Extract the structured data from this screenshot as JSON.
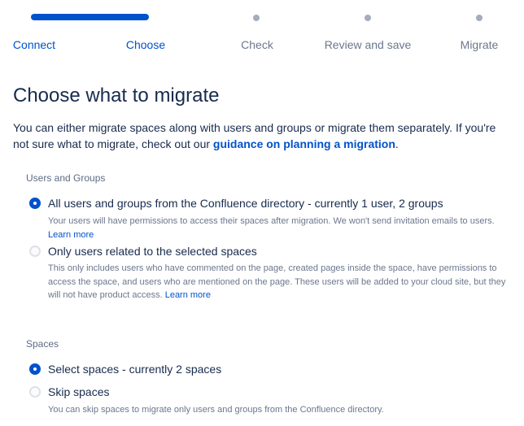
{
  "progress": {
    "steps": [
      {
        "label": "Connect",
        "state": "done"
      },
      {
        "label": "Choose",
        "state": "current"
      },
      {
        "label": "Check",
        "state": "todo"
      },
      {
        "label": "Review and save",
        "state": "todo"
      },
      {
        "label": "Migrate",
        "state": "todo"
      }
    ]
  },
  "page": {
    "title": "Choose what to migrate",
    "intro_text": "You can either migrate spaces along with users and groups or migrate them separately. If you're not sure what to migrate, check out our ",
    "intro_link": "guidance on planning a migration",
    "intro_end": "."
  },
  "users_groups": {
    "label": "Users and Groups",
    "options": [
      {
        "label": "All users and groups from the Confluence directory - currently 1 user, 2 groups",
        "checked": true,
        "description": "Your users will have permissions to access their spaces after migration. We won't send invitation emails to users.",
        "link": "Learn more"
      },
      {
        "label": "Only users related to the selected spaces",
        "checked": false,
        "description": "This only includes users who have commented on the page, created pages inside the space, have permissions to access the space, and users who are mentioned on the page. These users will be added to your cloud site, but they will not have product access.",
        "link": "Learn more"
      }
    ]
  },
  "spaces": {
    "label": "Spaces",
    "options": [
      {
        "label": "Select spaces - currently 2 spaces",
        "checked": true
      },
      {
        "label": "Skip spaces",
        "checked": false,
        "description": "You can skip spaces to migrate only users and groups from the Confluence directory."
      }
    ]
  },
  "colors": {
    "accent": "#0052cc",
    "text": "#172b4d",
    "subtle": "#6b778c",
    "track_inactive": "#a5adba"
  }
}
